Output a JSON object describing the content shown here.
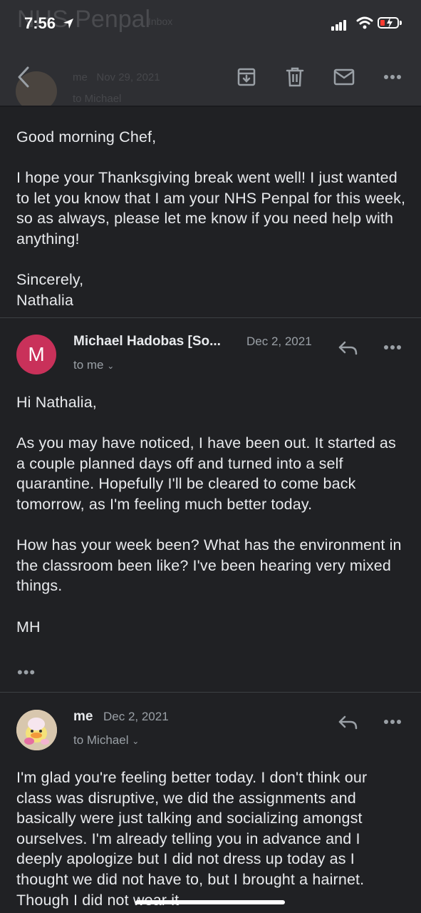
{
  "status_bar": {
    "time": "7:56"
  },
  "header_ghost": {
    "title": "NHS Penpal",
    "badge": "Inbox",
    "sender": "me",
    "date": "Nov 29, 2021",
    "to": "to Michael"
  },
  "toolbar": {
    "back_icon": "back-arrow-icon",
    "archive_icon": "archive-icon",
    "delete_icon": "trash-icon",
    "unread_icon": "mail-icon",
    "more_icon": "more-horizontal-icon"
  },
  "messages": [
    {
      "body": "Good morning Chef,\n\nI hope your Thanksgiving break went well! I just wanted to let you know that I am your NHS Penpal for this week, so as always, please let me know if you need help with anything!\n\nSincerely,\nNathalia"
    },
    {
      "avatar_letter": "M",
      "avatar_color": "#c9315a",
      "sender": "Michael Hadobas [So...",
      "date": "Dec 2, 2021",
      "to": "to me",
      "body": "Hi Nathalia,\n\nAs you may have noticed, I have been out. It started as a couple planned days off and turned into a self quarantine. Hopefully I'll be cleared to come back tomorrow, as I'm feeling much better today.\n\nHow has your week been? What has the environment in the classroom been like? I've been hearing very mixed things.\n\nMH",
      "trimmed": "•••"
    },
    {
      "sender": "me",
      "date": "Dec 2, 2021",
      "to": "to Michael",
      "body": "I'm glad you're feeling better today. I don't think our class was disruptive, we did the assignments and basically were just talking and socializing amongst ourselves. I'm already telling you in advance and I deeply apologize but I did not dress up today as I thought we did not have to, but I brought a hairnet. Though I did not wear it"
    }
  ],
  "colors": {
    "background": "#202124",
    "toolbar": "#2e2f33",
    "text": "#e8eaed",
    "secondary": "#9aa0a6",
    "divider": "#3c4043"
  }
}
